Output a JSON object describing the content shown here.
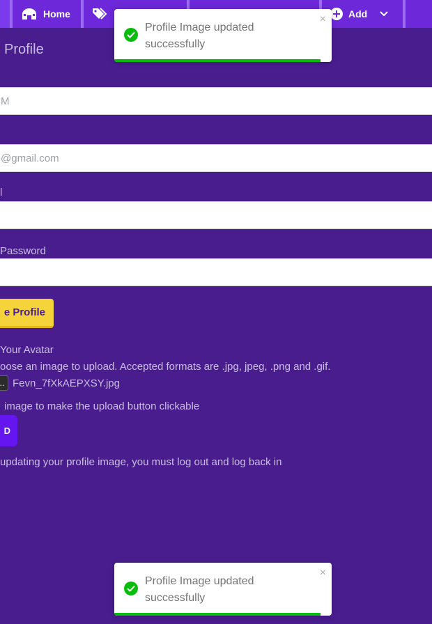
{
  "nav": {
    "home_label": "Home",
    "add_label": "Add"
  },
  "page": {
    "heading": "Profile",
    "name_placeholder": "M",
    "email_placeholder": "@gmail.com",
    "label_3": "l",
    "label_password": "Password",
    "save_label": "e Profile",
    "avatar_heading": "Your Avatar",
    "avatar_help": "oose an image to upload. Accepted formats are .jpg, jpeg, .png and .gif.",
    "file_button_label": "..",
    "file_name": "Fevn_7fXkAEPXSY.jpg",
    "upload_hint": "image to make the upload button clickable",
    "upload_label": "D",
    "relog_note": "updating your profile image, you must log out and log back in"
  },
  "toasts": [
    {
      "message": "Profile Image updated successfully",
      "close": "×",
      "progress": 0.95
    },
    {
      "message": "Profile Image updated successfully",
      "close": "×",
      "progress": 0.95
    }
  ],
  "colors": {
    "background": "#4a1d8f",
    "nav": "#7c3aed",
    "save_button": "#f5d33b",
    "upload_button": "#6515f0",
    "toast_success": "#07bc0c"
  }
}
